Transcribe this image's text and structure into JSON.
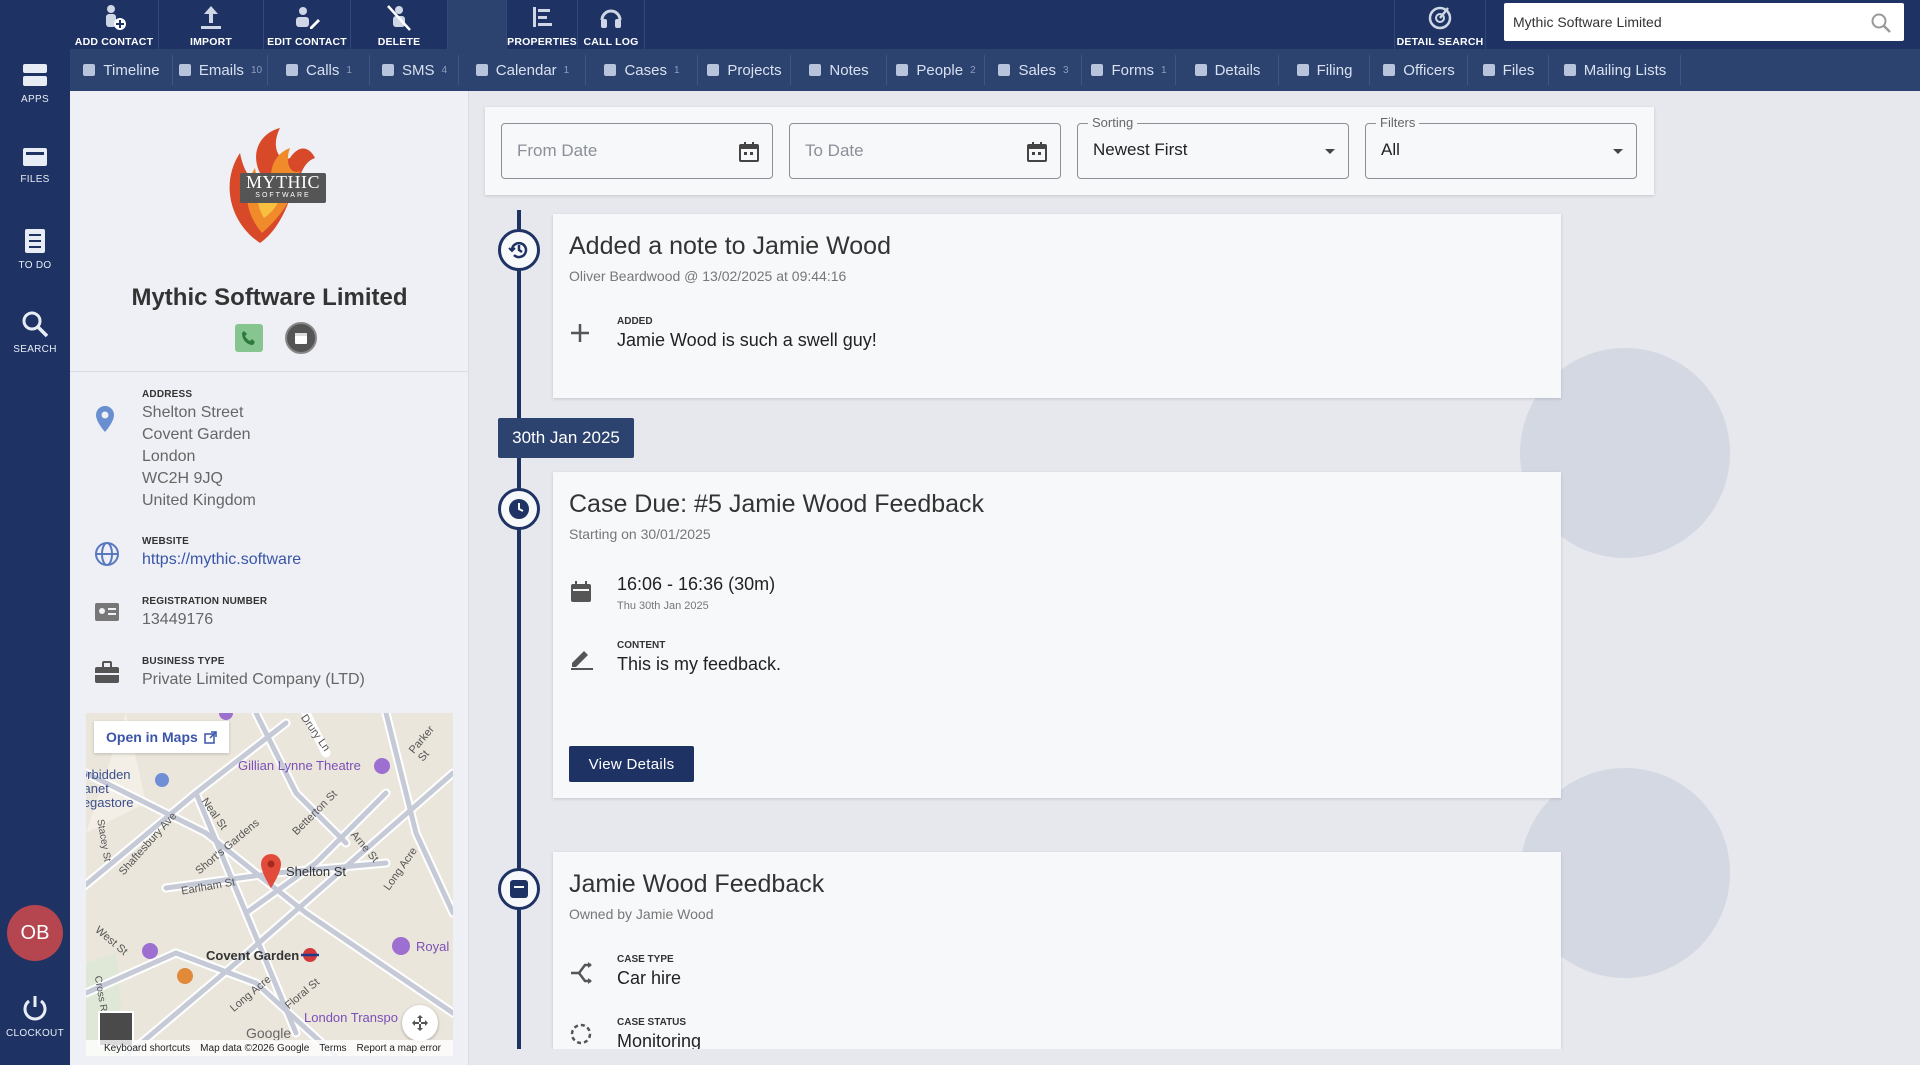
{
  "rail": {
    "apps": "APPS",
    "files": "FILES",
    "todo": "TO DO",
    "search": "SEARCH",
    "user_initials": "OB",
    "clockout": "CLOCKOUT"
  },
  "toolbar": {
    "add_contact": "ADD CONTACT",
    "import_contacts": "IMPORT CONTACTS",
    "edit_contact": "EDIT CONTACT",
    "delete_contact": "DELETE CONTACT",
    "properties": "PROPERTIES",
    "call_log": "CALL LOG",
    "detail_search": "DETAIL SEARCH",
    "search_value": "Mythic Software Limited"
  },
  "tabs": [
    {
      "label": "Timeline",
      "count": "",
      "icon": "timeline-icon"
    },
    {
      "label": "Emails",
      "count": "10",
      "icon": "email-icon"
    },
    {
      "label": "Calls",
      "count": "1",
      "icon": "phone-icon"
    },
    {
      "label": "SMS",
      "count": "4",
      "icon": "sms-icon"
    },
    {
      "label": "Calendar",
      "count": "1",
      "icon": "calendar-icon"
    },
    {
      "label": "Cases",
      "count": "1",
      "icon": "cases-icon"
    },
    {
      "label": "Projects",
      "count": "",
      "icon": "projects-icon"
    },
    {
      "label": "Notes",
      "count": "",
      "icon": "notes-icon"
    },
    {
      "label": "People",
      "count": "2",
      "icon": "people-icon"
    },
    {
      "label": "Sales",
      "count": "3",
      "icon": "sales-icon"
    },
    {
      "label": "Forms",
      "count": "1",
      "icon": "forms-icon"
    },
    {
      "label": "Details",
      "count": "",
      "icon": "details-icon"
    },
    {
      "label": "Filing",
      "count": "",
      "icon": "filing-icon"
    },
    {
      "label": "Officers",
      "count": "",
      "icon": "officers-icon"
    },
    {
      "label": "Files",
      "count": "",
      "icon": "folder-icon"
    },
    {
      "label": "Mailing Lists",
      "count": "",
      "icon": "mailing-icon"
    }
  ],
  "company": {
    "logo_text": "MYTHIC",
    "logo_sub": "SOFTWARE",
    "name": "Mythic Software Limited",
    "address_label": "ADDRESS",
    "address": [
      "Shelton Street",
      "Covent Garden",
      "London",
      "WC2H 9JQ",
      "United Kingdom"
    ],
    "website_label": "WEBSITE",
    "website": "https://mythic.software",
    "reg_label": "REGISTRATION NUMBER",
    "reg_number": "13449176",
    "btype_label": "BUSINESS TYPE",
    "btype": "Private Limited Company (LTD)"
  },
  "map": {
    "open": "Open in Maps",
    "labels": {
      "planet": "Forbidden Planet Megastore",
      "gillian": "Gillian Lynne Theatre",
      "drury": "Drury Ln",
      "parker": "Parker St",
      "neal": "Neal St",
      "shafts": "Shaftesbury Ave",
      "shorts": "Short's Gardens",
      "betterton": "Betterton St",
      "arne": "Arne St",
      "longacre": "Long Acre",
      "shelton": "Shelton St",
      "earlham": "Earlham St",
      "stacey": "Stacey St",
      "west": "West St",
      "covent": "Covent Garden",
      "royal": "Royal",
      "longacre2": "Long Acre",
      "floral": "Floral St",
      "transport": "London Transpo",
      "cross": "Cross Rd",
      "google": "Google"
    },
    "footer": {
      "shortcuts": "Keyboard shortcuts",
      "mapdata": "Map data ©2026 Google",
      "terms": "Terms",
      "report": "Report a map error"
    }
  },
  "filters": {
    "from_placeholder": "From Date",
    "to_placeholder": "To Date",
    "sorting_label": "Sorting",
    "sorting_value": "Newest First",
    "filters_label": "Filters",
    "filters_value": "All"
  },
  "timeline": {
    "note": {
      "title": "Added a note to Jamie Wood",
      "sub": "Oliver Beardwood @ 13/02/2025 at 09:44:16",
      "label": "ADDED",
      "value": "Jamie Wood is such a swell guy!"
    },
    "date_chip": "30th Jan 2025",
    "case_due": {
      "title": "Case Due: #5 Jamie Wood Feedback",
      "sub": "Starting on 30/01/2025",
      "time": "16:06 - 16:36 (30m)",
      "date": "Thu 30th Jan 2025",
      "content_label": "CONTENT",
      "content": "This is my feedback.",
      "button": "View Details"
    },
    "case": {
      "title": "Jamie Wood Feedback",
      "sub": "Owned by Jamie Wood",
      "type_label": "CASE TYPE",
      "type": "Car hire",
      "status_label": "CASE STATUS",
      "status": "Monitoring"
    }
  },
  "colors": {
    "navy": "#1e3364",
    "tabbar": "#2c426f",
    "link": "#3a55a8",
    "avatar": "#b5454e"
  }
}
